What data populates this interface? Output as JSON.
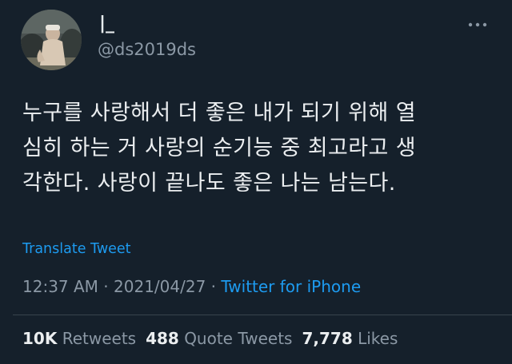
{
  "author": {
    "display_name": "|_",
    "handle": "@ds2019ds"
  },
  "more_icon": "more-horizontal-icon",
  "tweet": {
    "lines": [
      "누구를 사랑해서 더 좋은 내가 되기 위해 열",
      "심히 하는 거 사랑의 순기능 중 최고라고 생",
      "각한다. 사랑이 끝나도 좋은 나는 남는다."
    ],
    "translate_label": "Translate Tweet"
  },
  "meta": {
    "time": "12:37 AM",
    "separator": " · ",
    "date": "2021/04/27",
    "source": "Twitter for iPhone"
  },
  "stats": {
    "retweets_count": "10K",
    "retweets_label": "Retweets",
    "quotes_count": "488",
    "quotes_label": "Quote Tweets",
    "likes_count": "7,778",
    "likes_label": "Likes"
  },
  "colors": {
    "background": "#15202b",
    "text": "#ebeef0",
    "secondary": "#8b98a5",
    "accent": "#1d9bf0",
    "divider": "#38444d"
  }
}
